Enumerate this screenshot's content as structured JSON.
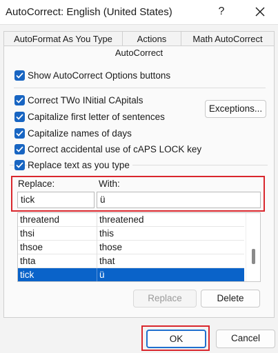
{
  "window": {
    "title": "AutoCorrect: English (United States)",
    "help_glyph": "?"
  },
  "tabs": {
    "autoformat_label": "AutoFormat As You Type",
    "actions_label": "Actions",
    "math_label": "Math AutoCorrect",
    "autocorrect_label": "AutoCorrect"
  },
  "options": {
    "show_buttons": {
      "label": "Show AutoCorrect Options buttons",
      "checked": true
    },
    "two_initial": {
      "label": "Correct TWo INitial CApitals",
      "checked": true
    },
    "first_letter": {
      "label": "Capitalize first letter of sentences",
      "checked": true
    },
    "names_days": {
      "label": "Capitalize names of days",
      "checked": true
    },
    "caps_lock": {
      "label": "Correct accidental use of cAPS LOCK key",
      "checked": true
    },
    "replace_text": {
      "label": "Replace text as you type",
      "checked": true
    }
  },
  "buttons": {
    "exceptions": "Exceptions...",
    "replace": "Replace",
    "delete": "Delete",
    "ok": "OK",
    "cancel": "Cancel"
  },
  "replace_section": {
    "replace_label": "Replace:",
    "with_label": "With:",
    "replace_value": "tick",
    "with_value": "ü"
  },
  "list": {
    "rows": [
      {
        "replace": "threatend",
        "with": "threatened"
      },
      {
        "replace": "thsi",
        "with": "this"
      },
      {
        "replace": "thsoe",
        "with": "those"
      },
      {
        "replace": "thta",
        "with": "that"
      },
      {
        "replace": "tick",
        "with": "ü"
      }
    ],
    "selected_index": 4
  },
  "colors": {
    "accent": "#1865c2",
    "highlight": "#d9262c",
    "selection": "#0a63c9"
  }
}
